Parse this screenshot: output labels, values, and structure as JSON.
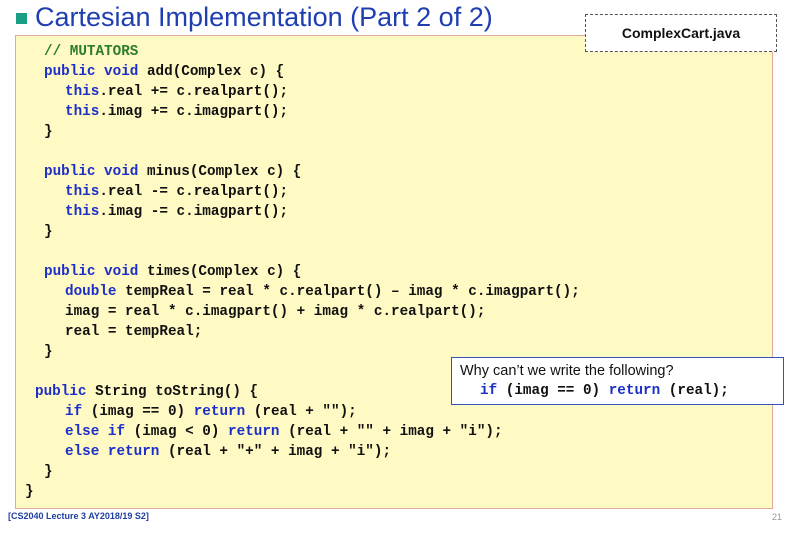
{
  "slide": {
    "title": "Cartesian Implementation (Part 2 of 2)",
    "filename": "ComplexCart.java",
    "footer": "[CS2040 Lecture 3 AY2018/19 S2]",
    "page_mark": "21"
  },
  "code": {
    "comment_mutators": "// MUTATORS",
    "add_sig_kw": "public void",
    "add_sig_rest": " add(Complex c) {",
    "add_l1_kw": "this",
    "add_l1_rest": ".real += c.realpart();",
    "add_l2_kw": "this",
    "add_l2_rest": ".imag += c.imagpart();",
    "add_close": "}",
    "minus_sig_kw": "public void",
    "minus_sig_rest": " minus(Complex c) {",
    "minus_l1_kw": "this",
    "minus_l1_rest": ".real -= c.realpart();",
    "minus_l2_kw": "this",
    "minus_l2_rest": ".imag -= c.imagpart();",
    "minus_close": "}",
    "times_sig_kw": "public void",
    "times_sig_rest": " times(Complex c) {",
    "times_l1_kw": "double",
    "times_l1_rest": " tempReal = real * c.realpart() – imag * c.imagpart();",
    "times_l2": "imag = real * c.imagpart() + imag * c.realpart();",
    "times_l3": "real = tempReal;",
    "times_close": "}",
    "tostring_sig_kw": "public",
    "tostring_sig_rest": " String toString() {",
    "ts_l1_kw1": "if",
    "ts_l1_mid": " (imag == 0) ",
    "ts_l1_kw2": "return",
    "ts_l1_rest": " (real + \"\");",
    "ts_l2_kw1": "else if",
    "ts_l2_mid": " (imag < 0) ",
    "ts_l2_kw2": "return",
    "ts_l2_rest": " (real + \"\" + imag + \"i\");",
    "ts_l3_kw1": "else return",
    "ts_l3_rest": " (real + \"+\" + imag + \"i\");",
    "ts_close": "}",
    "class_close": "}"
  },
  "callout": {
    "question": "Why can’t we write the following?",
    "code_kw1": "if",
    "code_mid": " (imag == 0) ",
    "code_kw2": "return",
    "code_rest": " (real);"
  },
  "colors": {
    "title": "#1f3fb0",
    "keyword": "#1c2fc9",
    "comment": "#2e7d2e",
    "code_background": "#fff9c4",
    "bullet": "#1a9e86"
  }
}
